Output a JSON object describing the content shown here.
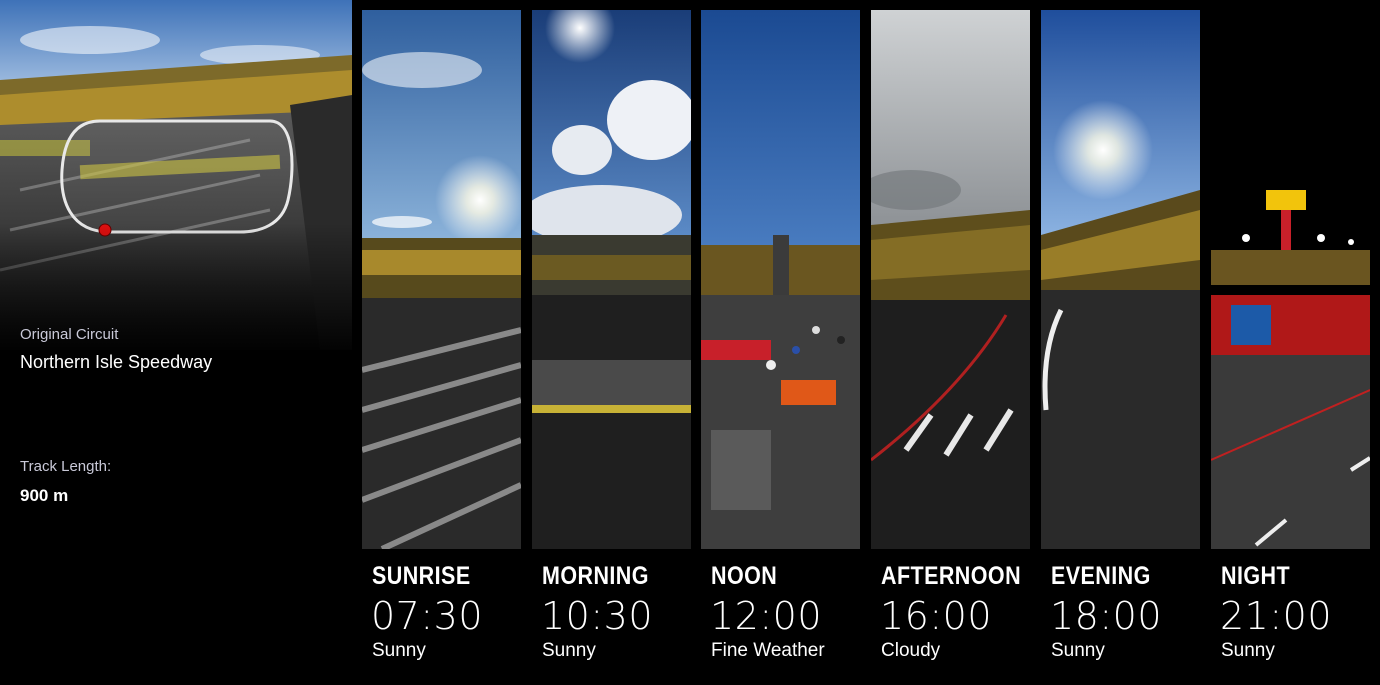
{
  "circuit": {
    "category_label": "Original Circuit",
    "name": "Northern Isle Speedway",
    "length_label": "Track Length:",
    "length_value": "900 m"
  },
  "time_slots": [
    {
      "name": "SUNRISE",
      "time": "07:30",
      "weather": "Sunny"
    },
    {
      "name": "MORNING",
      "time": "10:30",
      "weather": "Sunny"
    },
    {
      "name": "NOON",
      "time": "12:00",
      "weather": "Fine Weather"
    },
    {
      "name": "AFTERNOON",
      "time": "16:00",
      "weather": "Cloudy"
    },
    {
      "name": "EVENING",
      "time": "18:00",
      "weather": "Sunny"
    },
    {
      "name": "NIGHT",
      "time": "21:00",
      "weather": "Sunny"
    }
  ]
}
